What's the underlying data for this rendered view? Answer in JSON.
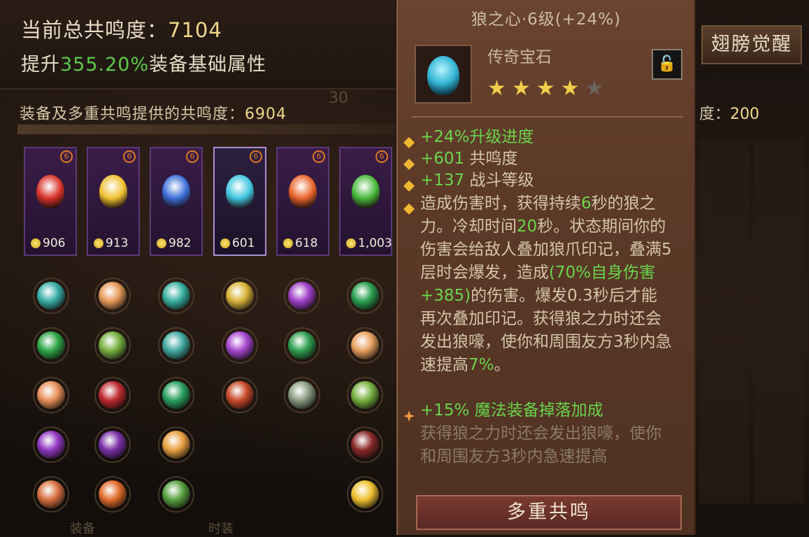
{
  "header": {
    "total_label": "当前总共鸣度：",
    "total_value": "7104",
    "boost_prefix": "提升",
    "boost_value": "355.20%",
    "boost_suffix": "装备基础属性"
  },
  "subheader": {
    "label": "装备及多重共鸣提供的共鸣度：",
    "value": "6904",
    "ghost": "30"
  },
  "right_panel": {
    "button_label": "翅膀觉醒",
    "resonance_label": "度：",
    "resonance_value": "200"
  },
  "legendary_gems": [
    {
      "name": "red-gem",
      "value": "906",
      "color": "#d8322a"
    },
    {
      "name": "gold-gem",
      "value": "913",
      "color": "#f0c030"
    },
    {
      "name": "blue-gem",
      "value": "982",
      "color": "#3a6ed8"
    },
    {
      "name": "wolf-heart-gem",
      "value": "601",
      "color": "#40c6e0"
    },
    {
      "name": "fire-gem",
      "value": "618",
      "color": "#e8642a"
    },
    {
      "name": "green-gem",
      "value": "1,003",
      "color": "#48b83a"
    }
  ],
  "normal_gems": [
    [
      "#3ab0a8",
      "#e89a5a",
      "#38b0a0",
      "#d8b43a",
      "#a040c8",
      "#2aa050"
    ],
    [
      "#30a848",
      "#78b040",
      "#40a8a0",
      "#a848d0",
      "#30a050",
      "#e8a060"
    ],
    [
      "#e8905a",
      "#c02a30",
      "#2aa060",
      "#c84a2a",
      "#8a9a80",
      "#78b040"
    ],
    [
      "#9038c0",
      "#7a30a8",
      "#e8a040",
      null,
      null,
      "#8a2a2a"
    ],
    [
      "#d87040",
      "#e06a2a",
      "#58a040",
      null,
      null,
      "#f0c030"
    ]
  ],
  "bottom_labels": [
    "装备",
    "时装"
  ],
  "tooltip": {
    "title": "狼之心·6级(+24%)",
    "type": "传奇宝石",
    "stars_on": 4,
    "stars_total": 5,
    "lock_icon": "unlock-icon",
    "attributes": [
      {
        "prefix": "+24%",
        "text": "升级进度"
      },
      {
        "prefix": "+601",
        "text": " 共鸣度"
      },
      {
        "prefix": "+137",
        "text": " 战斗等级"
      }
    ],
    "effect": {
      "p1": "造成伤害时，获得持续",
      "v1": "6",
      "p2": "秒的狼之力。冷却时间",
      "v2": "20",
      "p3": "秒。状态期间你的伤害会给敌人叠加狼爪印记，叠满5层时会爆发，造成",
      "v3": "(70%自身伤害+385)",
      "p4": "的伤害。爆发0.3秒后才能再次叠加印记。获得狼之力时还会发出狼嚎，使你和周围友方3秒内急速提高",
      "v4": "7%",
      "p5": "。"
    },
    "bonus": "+15% 魔法装备掉落加成",
    "locked_effect": "获得狼之力时还会发出狼嚎，使你和周围友方3秒内急速提高",
    "button_label": "多重共鸣"
  }
}
